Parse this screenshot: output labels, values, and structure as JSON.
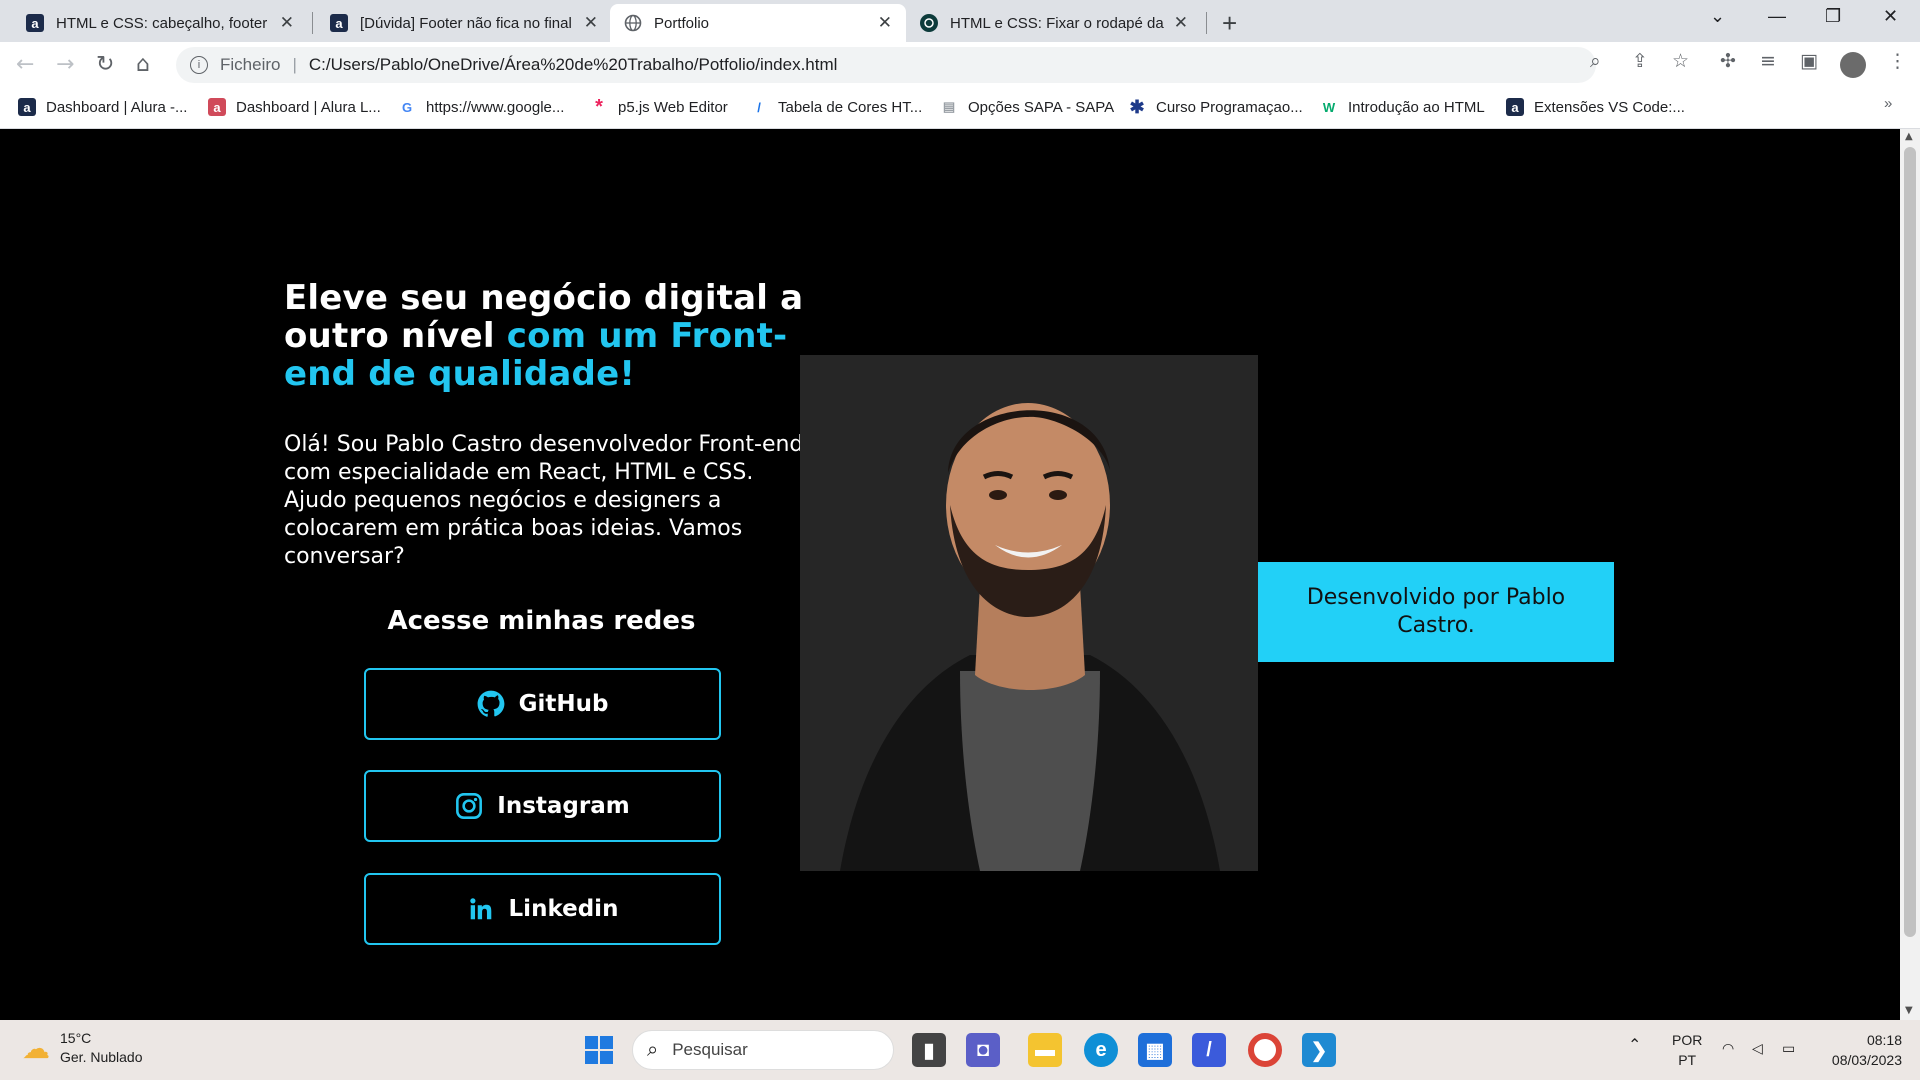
{
  "browser": {
    "tabs": [
      {
        "favicon": "alura-icon",
        "favicon_letter": "a",
        "title": "HTML e CSS: cabeçalho, footer e"
      },
      {
        "favicon": "alura-icon",
        "favicon_letter": "a",
        "title": "[Dúvida] Footer não fica no final"
      },
      {
        "favicon": "globe-icon",
        "favicon_letter": "",
        "title": "Portfolio"
      },
      {
        "favicon": "openai-icon",
        "favicon_letter": "",
        "title": "HTML e CSS: Fixar o rodapé da p"
      }
    ],
    "new_tab": "+",
    "address": {
      "scheme": "Ficheiro",
      "url": "C:/Users/Pablo/OneDrive/Área%20de%20Trabalho/Potfolio/index.html"
    },
    "bookmarks": [
      {
        "label": "Dashboard | Alura -...",
        "icon": "alura-icon",
        "letter": "a",
        "color": "#1c2b4a"
      },
      {
        "label": "Dashboard | Alura L...",
        "icon": "alura-icon",
        "letter": "a",
        "color": "#d04a5a"
      },
      {
        "label": "https://www.google...",
        "icon": "google-icon",
        "letter": "G",
        "color": "#4285f4"
      },
      {
        "label": "p5.js Web Editor",
        "icon": "p5-icon",
        "letter": "*",
        "color": "#ed225d"
      },
      {
        "label": "Tabela de Cores HT...",
        "icon": "brush-icon",
        "letter": "/",
        "color": "#1a73e8"
      },
      {
        "label": "Opções SAPA - SAPA",
        "icon": "doc-icon",
        "letter": "▤",
        "color": "#9aa0a6"
      },
      {
        "label": "Curso Programaçao...",
        "icon": "star-icon",
        "letter": "✱",
        "color": "#1e3a8a"
      },
      {
        "label": "Introdução ao HTML",
        "icon": "w3-icon",
        "letter": "W",
        "color": "#04aa6d"
      },
      {
        "label": "Extensões VS Code:...",
        "icon": "alura-icon",
        "letter": "a",
        "color": "#1c2b4a"
      }
    ]
  },
  "hero": {
    "headline_white": "Eleve seu negócio digital a outro nível ",
    "headline_accent": "com um Front-end de qualidade!",
    "intro": "Olá! Sou Pablo Castro desenvolvedor Front-end com especialidade em React, HTML e CSS. Ajudo pequenos negócios e designers a colocarem em prática boas ideias. Vamos conversar?",
    "social_title": "Acesse minhas redes",
    "social": [
      {
        "label": "GitHub",
        "icon": "github-icon"
      },
      {
        "label": "Instagram",
        "icon": "instagram-icon"
      },
      {
        "label": "Linkedin",
        "icon": "linkedin-icon"
      }
    ]
  },
  "footer": {
    "text": "Desenvolvido por Pablo Castro."
  },
  "taskbar": {
    "weather_temp": "15°C",
    "weather_desc": "Ger. Nublado",
    "search_placeholder": "Pesquisar",
    "lang_top": "POR",
    "lang_bottom": "PT",
    "time": "08:18",
    "date": "08/03/2023"
  },
  "colors": {
    "accent": "#22c6f0",
    "footer_bg": "#22d0f7",
    "page_bg": "#000000"
  }
}
